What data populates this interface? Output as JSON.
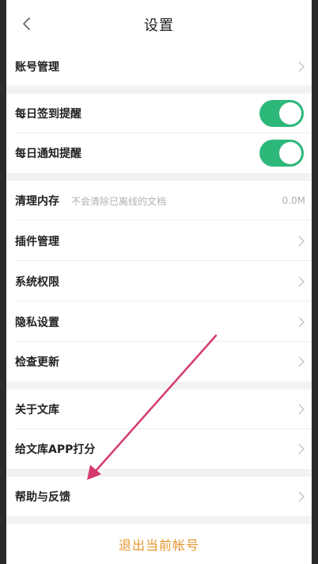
{
  "header": {
    "title": "设置"
  },
  "account": {
    "label": "账号管理"
  },
  "reminders": {
    "daily_signin": {
      "label": "每日签到提醒",
      "enabled": true
    },
    "daily_notify": {
      "label": "每日通知提醒",
      "enabled": true
    }
  },
  "clear_cache": {
    "label": "清理内存",
    "hint": "不会清除已离线的文档",
    "value": "0.0M"
  },
  "plugins": {
    "label": "插件管理"
  },
  "permissions": {
    "label": "系统权限"
  },
  "privacy": {
    "label": "隐私设置"
  },
  "update": {
    "label": "检查更新"
  },
  "about": {
    "label": "关于文库"
  },
  "rate": {
    "label": "给文库APP打分"
  },
  "help": {
    "label": "帮助与反馈"
  },
  "logout": {
    "label": "退出当前帐号"
  },
  "colors": {
    "toggle_on": "#2db87a",
    "logout_text": "#e8962e",
    "annotation_arrow": "#d43a6e"
  }
}
